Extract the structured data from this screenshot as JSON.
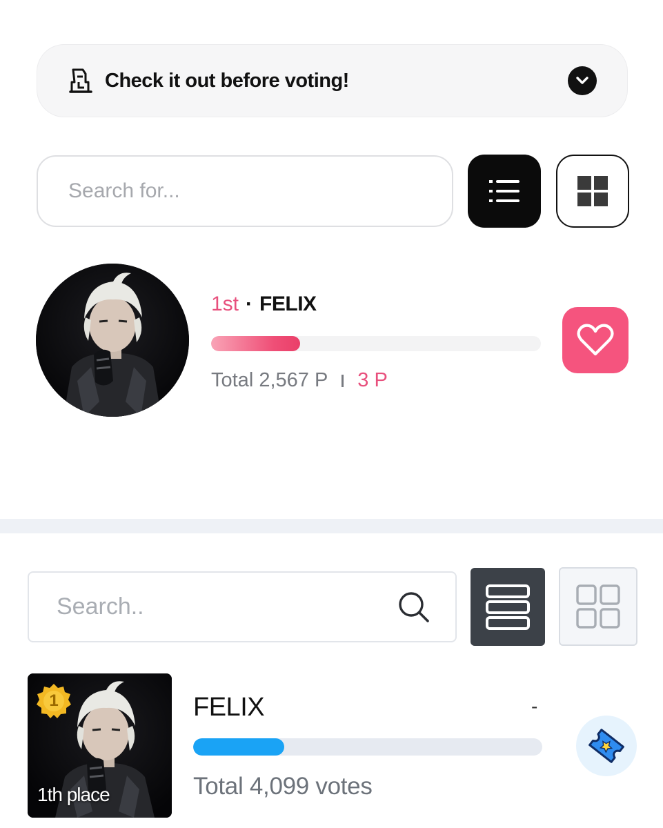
{
  "notice": {
    "text": "Check it out before voting!",
    "icon": "ballot-box-icon",
    "toggle_icon": "chevron-down-icon"
  },
  "section1": {
    "search": {
      "placeholder": "Search for..."
    },
    "view_modes": [
      "list-view-icon",
      "grid-view-icon"
    ],
    "candidate": {
      "rank": "1st",
      "separator": "·",
      "name": "FELIX",
      "progress_percent": 27,
      "total": "Total 2,567 P",
      "points": "3 P",
      "action_icon": "heart-icon"
    },
    "colors": {
      "accent": "#f5547e",
      "rank": "#e8507d"
    }
  },
  "section2": {
    "search": {
      "placeholder": "Search.."
    },
    "view_modes": [
      "card-list-icon",
      "grid-view-icon"
    ],
    "candidate": {
      "badge": "1",
      "place": "1th place",
      "name": "FELIX",
      "change": "-",
      "progress_percent": 26,
      "total": "Total 4,099 votes",
      "action_icon": "ticket-icon"
    },
    "colors": {
      "bar": "#1aa3f5"
    }
  }
}
